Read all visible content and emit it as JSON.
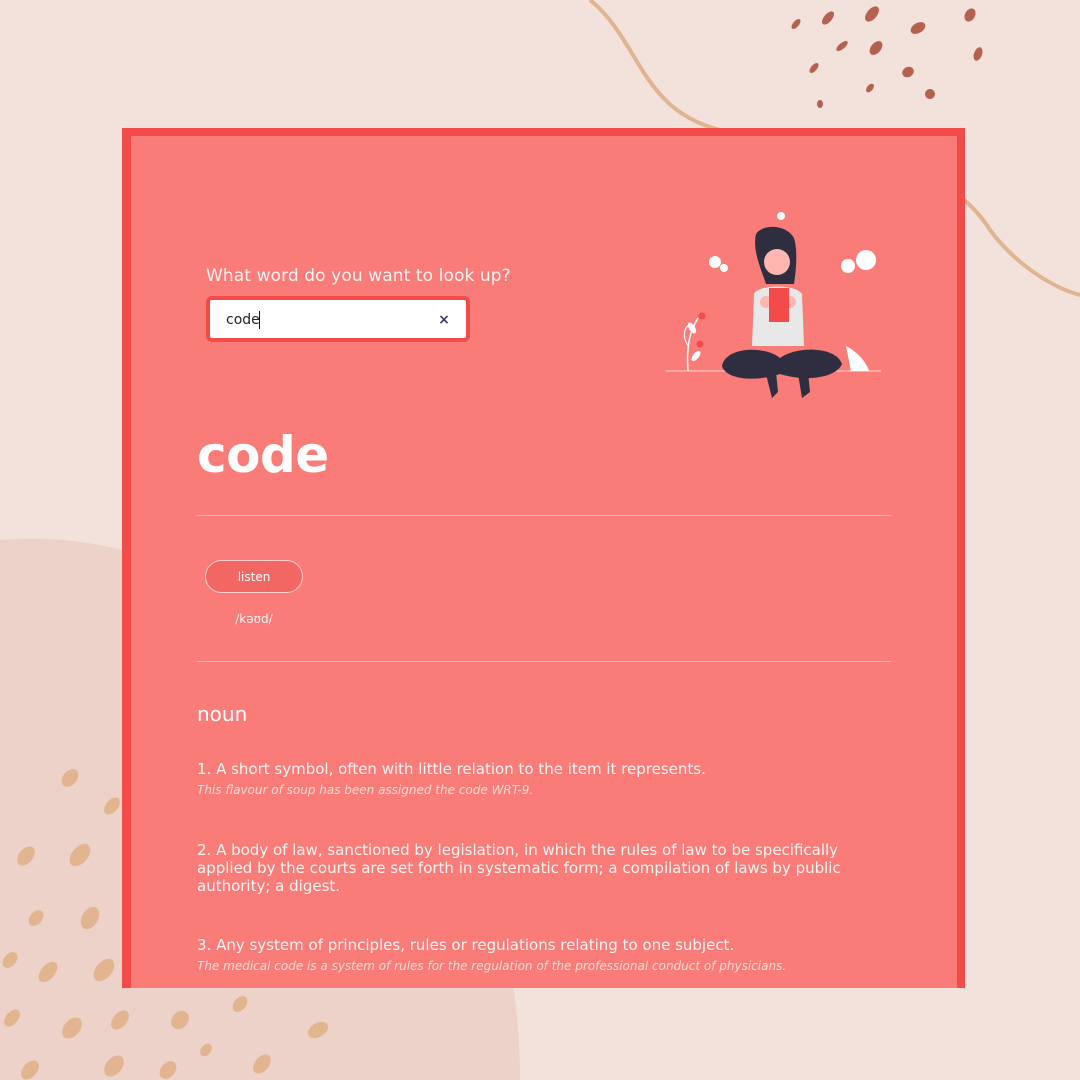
{
  "search": {
    "prompt": "What word do you want to look up?",
    "value": "code",
    "clear_icon": "×"
  },
  "entry": {
    "word": "code",
    "listen_label": "listen",
    "phonetic": "/kəʊd/",
    "part_of_speech": "noun",
    "definitions": [
      {
        "text": "1. A short symbol, often with little relation to the item it represents.",
        "example": "This flavour of soup has been assigned the code WRT-9."
      },
      {
        "text": "2. A body of law, sanctioned by legislation, in which the rules of law to be specifically applied by the courts are set forth in systematic form; a compilation of laws by public authority; a digest.",
        "example": ""
      },
      {
        "text": "3. Any system of principles, rules or regulations relating to one subject.",
        "example": "The medical code is a system of rules for the regulation of the professional conduct of physicians."
      }
    ]
  },
  "colors": {
    "background": "#f3e1dc",
    "card": "#f97c78",
    "accent": "#f24b4a"
  },
  "icons": {
    "clear": "close-icon",
    "illustration": "person-reading-illustration"
  }
}
